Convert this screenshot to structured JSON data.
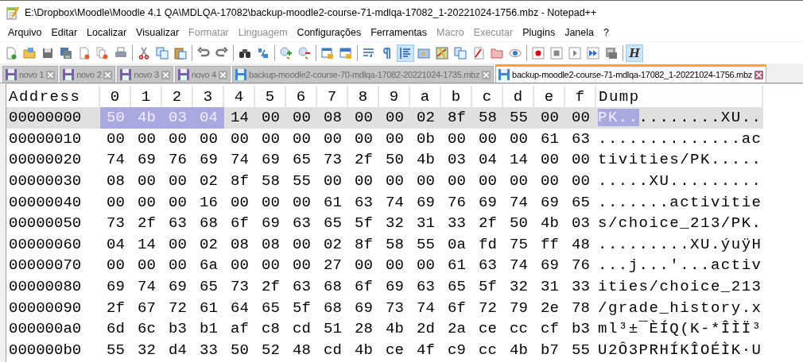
{
  "window": {
    "title": "E:\\Dropbox\\Moodle\\Moodle 4.1 QA\\MDLQA-17082\\backup-moodle2-course-71-mdlqa-17082_1-20221024-1756.mbz - Notepad++"
  },
  "menu": [
    {
      "label": "Arquivo",
      "disabled": false
    },
    {
      "label": "Editar",
      "disabled": false
    },
    {
      "label": "Localizar",
      "disabled": false
    },
    {
      "label": "Visualizar",
      "disabled": false
    },
    {
      "label": "Formatar",
      "disabled": true
    },
    {
      "label": "Linguagem",
      "disabled": true
    },
    {
      "label": "Configurações",
      "disabled": false
    },
    {
      "label": "Ferramentas",
      "disabled": false
    },
    {
      "label": "Macro",
      "disabled": true
    },
    {
      "label": "Executar",
      "disabled": true
    },
    {
      "label": "Plugins",
      "disabled": false
    },
    {
      "label": "Janela",
      "disabled": false
    },
    {
      "label": "?",
      "disabled": false
    }
  ],
  "toolbar": [
    [
      {
        "kind": "new",
        "pressed": false
      },
      {
        "kind": "open",
        "pressed": false
      },
      {
        "kind": "save",
        "pressed": false
      },
      {
        "kind": "save-all",
        "pressed": false
      },
      {
        "kind": "close",
        "pressed": false
      },
      {
        "kind": "close-all",
        "pressed": false
      },
      {
        "kind": "print",
        "pressed": false
      }
    ],
    [
      {
        "kind": "cut",
        "pressed": false
      },
      {
        "kind": "copy",
        "pressed": false
      },
      {
        "kind": "paste",
        "pressed": false
      }
    ],
    [
      {
        "kind": "undo",
        "pressed": false
      },
      {
        "kind": "redo",
        "pressed": false
      }
    ],
    [
      {
        "kind": "find",
        "pressed": false
      },
      {
        "kind": "replace",
        "pressed": false
      }
    ],
    [
      {
        "kind": "zoom-in",
        "pressed": false
      },
      {
        "kind": "zoom-out",
        "pressed": false
      }
    ],
    [
      {
        "kind": "sync-vertical",
        "pressed": false
      },
      {
        "kind": "sync-horizontal",
        "pressed": false
      }
    ],
    [
      {
        "kind": "wrap",
        "pressed": false
      },
      {
        "kind": "all-chars",
        "pressed": false
      },
      {
        "kind": "indent",
        "pressed": true
      },
      {
        "kind": "lang",
        "pressed": false
      },
      {
        "kind": "map",
        "pressed": false
      },
      {
        "kind": "docs",
        "pressed": false
      },
      {
        "kind": "function",
        "pressed": false
      },
      {
        "kind": "folder",
        "pressed": false
      },
      {
        "kind": "monitor",
        "pressed": false
      }
    ],
    [
      {
        "kind": "record",
        "pressed": false
      },
      {
        "kind": "stop",
        "pressed": false
      },
      {
        "kind": "play",
        "pressed": false
      },
      {
        "kind": "play-multi",
        "pressed": false
      },
      {
        "kind": "save-macro",
        "pressed": false
      }
    ],
    [
      {
        "kind": "hex",
        "pressed": true,
        "label": "H"
      }
    ]
  ],
  "tabs": [
    {
      "label": "novo 1",
      "selected": false,
      "color": "#7a62a8"
    },
    {
      "label": "novo 2",
      "selected": false,
      "color": "#7a62a8"
    },
    {
      "label": "novo 3",
      "selected": false,
      "color": "#7a62a8"
    },
    {
      "label": "novo 4",
      "selected": false,
      "color": "#7a62a8"
    },
    {
      "label": "backup-moodle2-course-70-mdlqa-17082-20221024-1735.mbz",
      "selected": false,
      "color": "#3f86d0"
    },
    {
      "label": "backup-moodle2-course-71-mdlqa-17082_1-20221024-1756.mbz",
      "selected": true,
      "color": "#3f86d0"
    }
  ],
  "hex": {
    "columns": [
      "Address",
      "0",
      "1",
      "2",
      "3",
      "4",
      "5",
      "6",
      "7",
      "8",
      "9",
      "a",
      "b",
      "c",
      "d",
      "e",
      "f",
      "Dump"
    ],
    "rows": [
      {
        "address": "00000000",
        "selected": true,
        "marked_bytes": [
          "50",
          "4b",
          "03",
          "04"
        ],
        "bytes": [
          "14",
          "00",
          "00",
          "08",
          "00",
          "00",
          "02",
          "8f",
          "58",
          "55",
          "00",
          "00"
        ],
        "marked_dump": "PK..",
        "dump": "........XU.."
      },
      {
        "address": "00000010",
        "selected": false,
        "bytes": [
          "00",
          "00",
          "00",
          "00",
          "00",
          "00",
          "00",
          "00",
          "00",
          "00",
          "0b",
          "00",
          "00",
          "00",
          "61",
          "63"
        ],
        "dump": "..............ac"
      },
      {
        "address": "00000020",
        "selected": false,
        "bytes": [
          "74",
          "69",
          "76",
          "69",
          "74",
          "69",
          "65",
          "73",
          "2f",
          "50",
          "4b",
          "03",
          "04",
          "14",
          "00",
          "00"
        ],
        "dump": "tivities/PK....."
      },
      {
        "address": "00000030",
        "selected": false,
        "bytes": [
          "08",
          "00",
          "00",
          "02",
          "8f",
          "58",
          "55",
          "00",
          "00",
          "00",
          "00",
          "00",
          "00",
          "00",
          "00",
          "00"
        ],
        "dump": ".....XU........."
      },
      {
        "address": "00000040",
        "selected": false,
        "bytes": [
          "00",
          "00",
          "00",
          "16",
          "00",
          "00",
          "00",
          "61",
          "63",
          "74",
          "69",
          "76",
          "69",
          "74",
          "69",
          "65"
        ],
        "dump": ".......activitie"
      },
      {
        "address": "00000050",
        "selected": false,
        "bytes": [
          "73",
          "2f",
          "63",
          "68",
          "6f",
          "69",
          "63",
          "65",
          "5f",
          "32",
          "31",
          "33",
          "2f",
          "50",
          "4b",
          "03"
        ],
        "dump": "s/choice_213/PK."
      },
      {
        "address": "00000060",
        "selected": false,
        "bytes": [
          "04",
          "14",
          "00",
          "02",
          "08",
          "08",
          "00",
          "02",
          "8f",
          "58",
          "55",
          "0a",
          "fd",
          "75",
          "ff",
          "48"
        ],
        "dump": ".........XU.ýuÿH"
      },
      {
        "address": "00000070",
        "selected": false,
        "bytes": [
          "00",
          "00",
          "00",
          "6a",
          "00",
          "00",
          "00",
          "27",
          "00",
          "00",
          "00",
          "61",
          "63",
          "74",
          "69",
          "76"
        ],
        "dump": "...j...'...activ"
      },
      {
        "address": "00000080",
        "selected": false,
        "bytes": [
          "69",
          "74",
          "69",
          "65",
          "73",
          "2f",
          "63",
          "68",
          "6f",
          "69",
          "63",
          "65",
          "5f",
          "32",
          "31",
          "33"
        ],
        "dump": "ities/choice_213"
      },
      {
        "address": "00000090",
        "selected": false,
        "bytes": [
          "2f",
          "67",
          "72",
          "61",
          "64",
          "65",
          "5f",
          "68",
          "69",
          "73",
          "74",
          "6f",
          "72",
          "79",
          "2e",
          "78"
        ],
        "dump": "/grade_history.x"
      },
      {
        "address": "000000a0",
        "selected": false,
        "bytes": [
          "6d",
          "6c",
          "b3",
          "b1",
          "af",
          "c8",
          "cd",
          "51",
          "28",
          "4b",
          "2d",
          "2a",
          "ce",
          "cc",
          "cf",
          "b3"
        ],
        "dump": "ml³±¯ÈÍQ(K-*ÎÌÏ³"
      },
      {
        "address": "000000b0",
        "selected": false,
        "bytes": [
          "55",
          "32",
          "d4",
          "33",
          "50",
          "52",
          "48",
          "cd",
          "4b",
          "ce",
          "4f",
          "c9",
          "cc",
          "4b",
          "b7",
          "55"
        ],
        "dump": "U2Ô3PRHÍKÎOÉÌK·U"
      }
    ]
  }
}
